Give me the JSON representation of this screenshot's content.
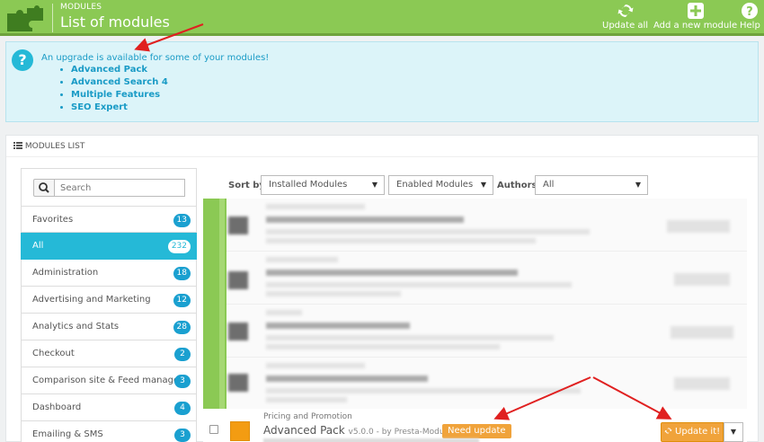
{
  "header": {
    "breadcrumb": "MODULES",
    "title": "List of modules",
    "toolbar": [
      {
        "label": "Update all",
        "icon": "refresh-icon"
      },
      {
        "label": "Add a new module",
        "icon": "plus-square-icon"
      },
      {
        "label": "Help",
        "icon": "help-icon"
      }
    ]
  },
  "alert": {
    "message": "An upgrade is available for some of your modules!",
    "modules": [
      "Advanced Pack",
      "Advanced Search 4",
      "Multiple Features",
      "SEO Expert"
    ]
  },
  "panel": {
    "title": "MODULES LIST"
  },
  "search": {
    "placeholder": "Search"
  },
  "categories": [
    {
      "label": "Favorites",
      "count": "13"
    },
    {
      "label": "All",
      "count": "232"
    },
    {
      "label": "Administration",
      "count": "18"
    },
    {
      "label": "Advertising and Marketing",
      "count": "12"
    },
    {
      "label": "Analytics and Stats",
      "count": "28"
    },
    {
      "label": "Checkout",
      "count": "2"
    },
    {
      "label": "Comparison site & Feed manage...",
      "count": "3"
    },
    {
      "label": "Dashboard",
      "count": "4"
    },
    {
      "label": "Emailing & SMS",
      "count": "3"
    }
  ],
  "filters": {
    "sort_label": "Sort by",
    "sort_value": "Installed Modules",
    "status_value": "Enabled Modules",
    "authors_label": "Authors",
    "authors_value": "All"
  },
  "module": {
    "category": "Pricing and Promotion",
    "name": "Advanced Pack",
    "version": "v5.0.0 - by Presta-Module",
    "badge": "Need update",
    "action": "Update it!"
  },
  "colors": {
    "header_green": "#8bc954",
    "accent_blue": "#25b9d7",
    "warning_orange": "#f0a33b",
    "arrow_red": "#e02020"
  }
}
